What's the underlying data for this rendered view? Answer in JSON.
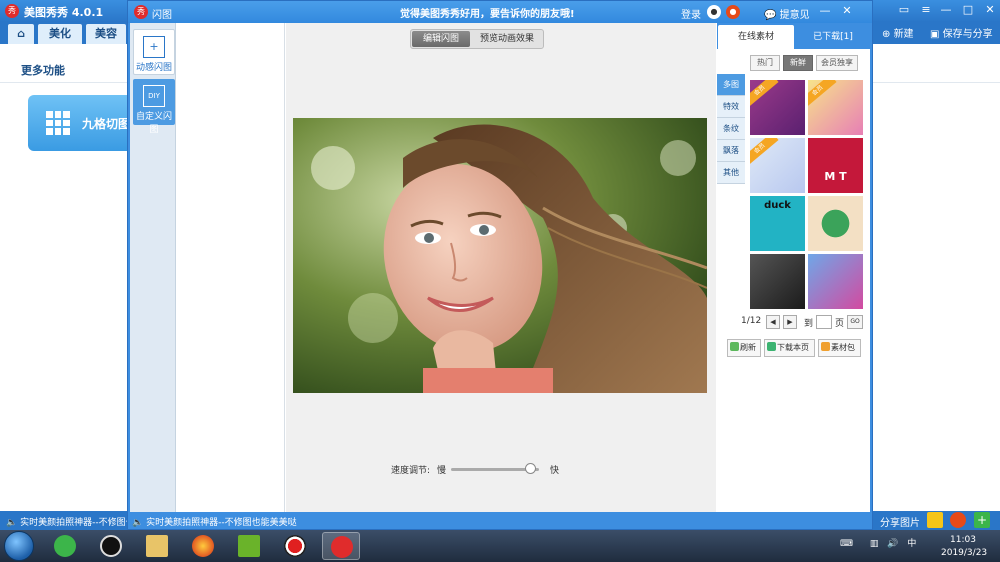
{
  "app": {
    "title": "美图秀秀 4.0.1",
    "nav_tabs": [
      "美化",
      "美容"
    ],
    "new_label": "新建",
    "save_label": "保存与分享",
    "more_features": "更多功能",
    "grid_button": "九格切图",
    "status_text": "实时美颜拍照神器--不修图也能美美哒",
    "share_label": "分享图片"
  },
  "dialog": {
    "title": "闪图",
    "slogan": "觉得美图秀秀好用，要告诉你的朋友哦!",
    "login": "登录",
    "feedback": "提意见",
    "left_tabs": [
      "动感闪图",
      "自定义闪图"
    ],
    "left_tab_icons": [
      "plus-square-icon",
      "diy-icon"
    ],
    "mode_tabs": {
      "edit": "编辑闪图",
      "preview": "预览动画效果"
    },
    "speed": {
      "label": "速度调节:",
      "slow": "慢",
      "fast": "快",
      "value": 0.9
    },
    "status_text": "实时美颜拍照神器--不修图也能美美哒"
  },
  "materials": {
    "tabs": {
      "online": "在线素材",
      "downloaded": "已下载[1]"
    },
    "filters": {
      "hot": "热门",
      "new": "新鲜",
      "vip": "会员独享"
    },
    "categories": [
      "多图",
      "特效",
      "条纹",
      "飘落",
      "其他"
    ],
    "active_category": "多图",
    "thumb_vip_label": "会员",
    "thumb_text": {
      "duck": "duck",
      "mt": "M T"
    },
    "pager": {
      "page": "1/12",
      "goto": "到",
      "page_unit": "页",
      "go": "GO"
    },
    "actions": {
      "refresh": "刷新",
      "download_page": "下载本页",
      "package": "素材包"
    }
  },
  "taskbar": {
    "time": "11:03",
    "date": "2019/3/23",
    "apps": [
      "360-icon",
      "qq-icon",
      "explorer-icon",
      "firefox-icon",
      "media-player-icon",
      "recorder-icon",
      "meitu-icon"
    ]
  },
  "colors": {
    "accent": "#3d8ee0",
    "title_bar": "#2a76c8",
    "taskbar": "#1f2c3e"
  }
}
